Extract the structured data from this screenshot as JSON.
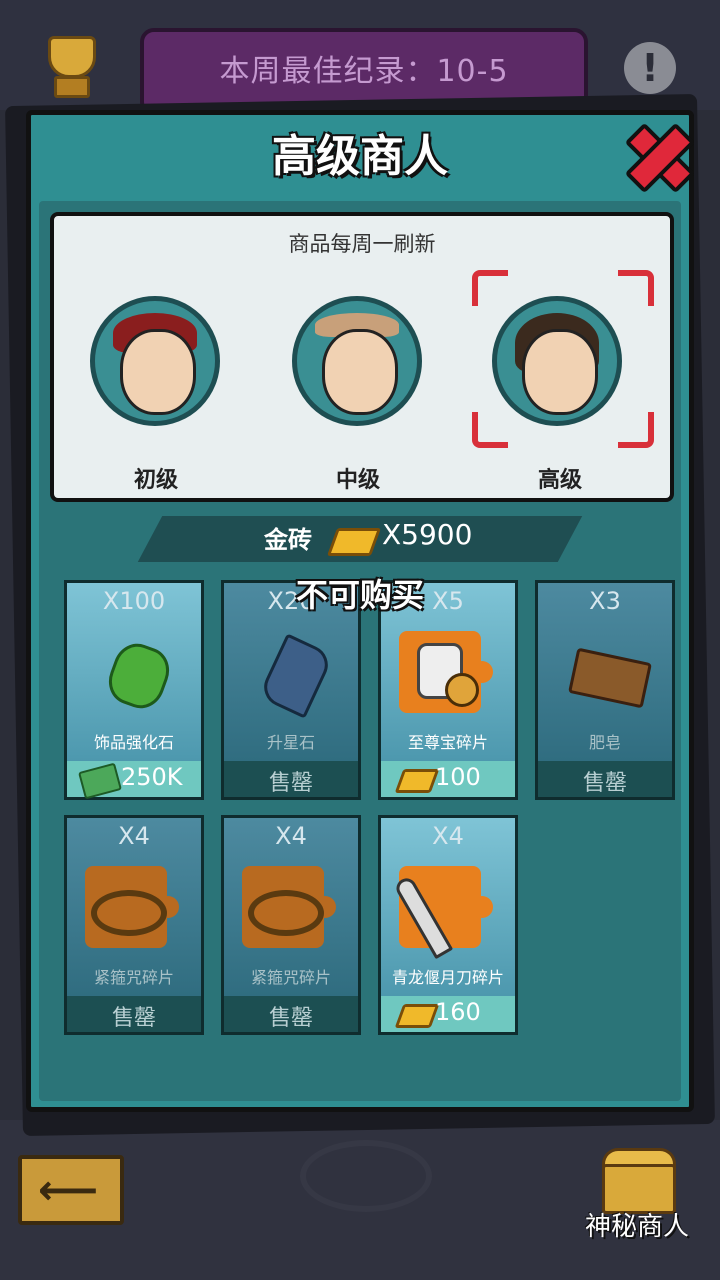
{
  "header": {
    "best_record": "本周最佳纪录：10-5",
    "info_label": "!"
  },
  "panel": {
    "title": "高级商人",
    "refresh_note": "商品每周一刷新"
  },
  "merchants": [
    {
      "label": "初级",
      "selected": false
    },
    {
      "label": "中级",
      "selected": false
    },
    {
      "label": "高级",
      "selected": true
    }
  ],
  "currency": {
    "label": "金砖",
    "amount": "X5900"
  },
  "unavailable_notice": "不可购买",
  "items": [
    {
      "qty": "X100",
      "name": "饰品强化石",
      "price": "250K",
      "price_icon": "cash-icon",
      "sold_out": false
    },
    {
      "qty": "X20",
      "name": "升星石",
      "price": "售罄",
      "sold_out": true
    },
    {
      "qty": "X5",
      "name": "至尊宝碎片",
      "price": "100",
      "price_icon": "gold-brick-icon",
      "sold_out": false
    },
    {
      "qty": "X3",
      "name": "肥皂",
      "price": "售罄",
      "sold_out": true
    },
    {
      "qty": "X4",
      "name": "紧箍咒碎片",
      "price": "售罄",
      "sold_out": true
    },
    {
      "qty": "X4",
      "name": "紧箍咒碎片",
      "price": "售罄",
      "sold_out": true
    },
    {
      "qty": "X4",
      "name": "青龙偃月刀碎片",
      "price": "160",
      "price_icon": "gold-brick-icon",
      "sold_out": false
    }
  ],
  "footer": {
    "back_icon": "arrow-left-icon",
    "secret_merchant": "神秘商人"
  }
}
